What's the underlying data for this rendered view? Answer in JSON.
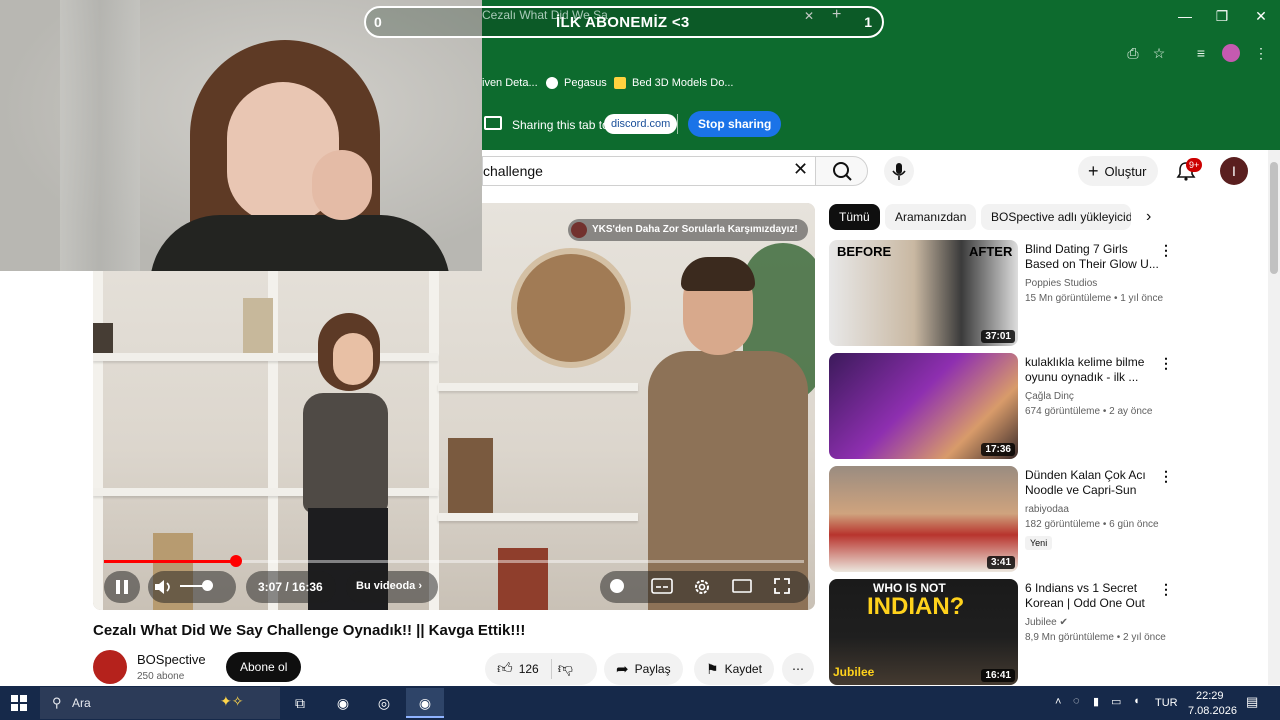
{
  "overlay": {
    "left_count": "0",
    "text": "İLK ABONEMİZ <3",
    "right_count": "1"
  },
  "browser": {
    "tab_title": "Cezalı What Did We Sa",
    "bookmarks": [
      {
        "label": "iven Deta..."
      },
      {
        "label": "Pegasus"
      },
      {
        "label": "Bed 3D Models Do..."
      }
    ],
    "share": {
      "text": "Sharing this tab to",
      "target": "discord.com",
      "stop_label": "Stop sharing"
    }
  },
  "youtube": {
    "search_value": "challenge",
    "create_label": "Oluştur",
    "notif_count": "9+",
    "avatar_letter": "I",
    "chips": [
      "Tümü",
      "Aramanızdan",
      "BOSpective adlı yükleyiciden"
    ],
    "player": {
      "current_time": "3:07",
      "duration": "16:36",
      "time_display": "3:07 / 16:36",
      "chapter_label": "Bu videoda",
      "banner_text": "YKS'den Daha Zor Sorularla Karşımızdayız!",
      "progress": 0.188,
      "volume": 0.6
    },
    "video": {
      "title": "Cezalı What Did We Say Challenge Oynadık!! || Kavga Ettik!!!",
      "channel": "BOSpective",
      "subs": "250 abone",
      "subscribe_label": "Abone ol",
      "likes": "126",
      "share_label": "Paylaş",
      "save_label": "Kaydet"
    },
    "recommended": [
      {
        "title": "Blind Dating 7 Girls Based on Their Glow U...",
        "channel": "Poppies Studios",
        "meta": "15 Mn görüntüleme • 1 yıl önce",
        "duration": "37:01",
        "badge": ""
      },
      {
        "title": "kulaklıkla kelime bilme oyunu oynadık - ilk ...",
        "channel": "Çağla Dinç",
        "meta": "674 görüntüleme • 2 ay önce",
        "duration": "17:36",
        "badge": ""
      },
      {
        "title": "Dünden Kalan Çok Acı Noodle ve Capri-Sun",
        "channel": "rabiyodaa",
        "meta": "182 görüntüleme • 6 gün önce",
        "duration": "3:41",
        "badge": "Yeni"
      },
      {
        "title": "6 Indians vs 1 Secret Korean | Odd One Out",
        "channel": "Jubilee",
        "meta": "8,9 Mn görüntüleme • 2 yıl önce",
        "duration": "16:41",
        "badge": ""
      }
    ],
    "thumb_texts": {
      "before": "BEFORE",
      "after": "AFTER",
      "who": "WHO IS NOT",
      "indian": "INDIAN?",
      "jubilee": "Jubilee"
    }
  },
  "taskbar": {
    "search_placeholder": "Ara",
    "lang": "TUR",
    "time": "22:29",
    "date": "7.08.2026"
  },
  "colors": {
    "chrome_green": "#0d6b2e",
    "yt_red": "#ff0000",
    "stop_blue": "#1a73e8",
    "taskbar": "#16294a"
  }
}
